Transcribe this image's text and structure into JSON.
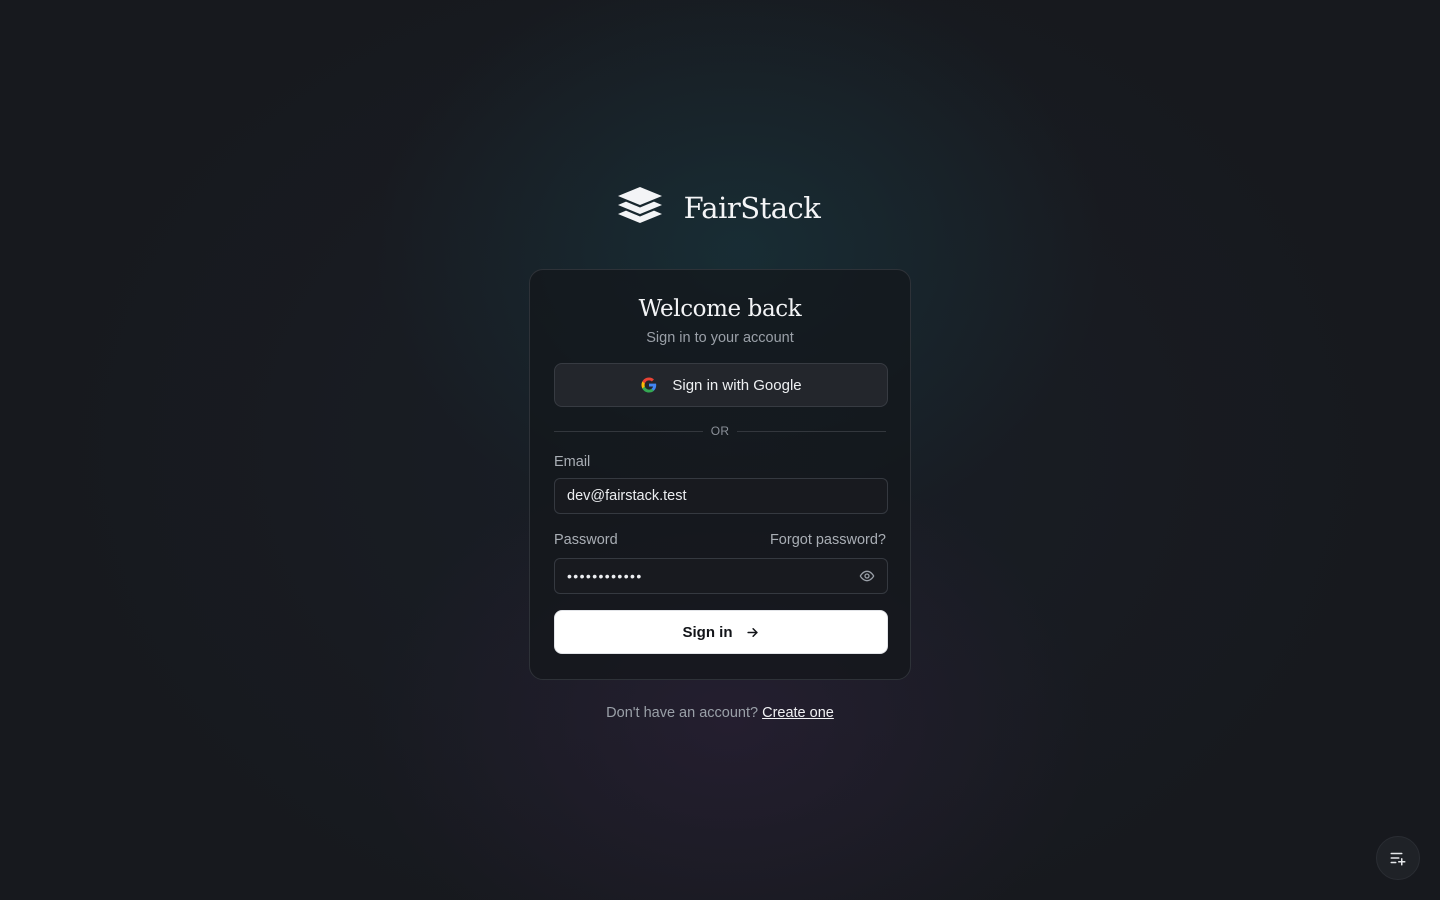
{
  "brand": {
    "name": "FairStack",
    "logo_icon": "stacked-layers-icon"
  },
  "card": {
    "title": "Welcome back",
    "subtitle": "Sign in to your account",
    "google_button_label": "Sign in with Google",
    "google_icon": "google-g-icon",
    "divider_text": "OR",
    "email": {
      "label": "Email",
      "value": "dev@fairstack.test"
    },
    "password": {
      "label": "Password",
      "forgot_label": "Forgot password?",
      "masked_value": "••••••••••••",
      "toggle_icon": "eye-icon"
    },
    "submit_label": "Sign in",
    "submit_icon": "arrow-right-icon"
  },
  "footer": {
    "prompt": "Don't have an account?",
    "link": "Create one"
  },
  "corner_button": {
    "icon": "list-sparkle-icon"
  },
  "colors": {
    "background": "#17191e",
    "card_border": "#2e3238",
    "primary_button": "#ffffff",
    "muted_text": "#9aa0a8"
  }
}
